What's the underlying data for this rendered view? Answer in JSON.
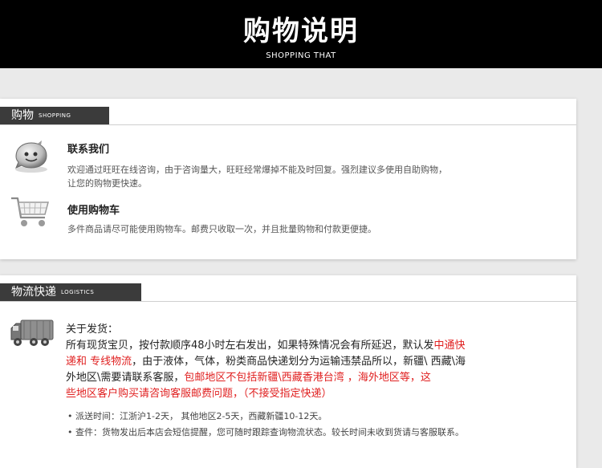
{
  "header": {
    "title": "购物说明",
    "subtitle": "SHOPPING THAT"
  },
  "shopping": {
    "tab_cn": "购物",
    "tab_en": "SHOPPING",
    "contact": {
      "icon": "wangwang-chat-icon",
      "title": "联系我们",
      "desc_line1": "欢迎通过旺旺在线咨询，由于咨询量大，旺旺经常爆掉不能及时回复。强烈建议多使用自助购物，",
      "desc_line2": "让您的购物更快速。"
    },
    "cart": {
      "icon": "shopping-cart-icon",
      "title": "使用购物车",
      "desc": "多件商品请尽可能使用购物车。邮费只收取一次，并且批量购物和付款更便捷。"
    }
  },
  "logistics": {
    "tab_cn": "物流快递",
    "tab_en": "LOGISTICS",
    "icon": "delivery-truck-icon",
    "heading": "关于发货：",
    "p1": "所有现货宝贝，按付款顺序48小时左右发出，如果特殊情况会有所延迟，默认发",
    "p1_red": "中通快",
    "p2_red": "递和 专线物流",
    "p2": "，由于液体，气体，粉类商品快递划分为运输违禁品所以，新疆\\ 西藏\\海",
    "p3": "外地区\\需要请联系客服，",
    "p3_red": "包邮地区不包括新疆\\西藏香港台湾 ，海外地区等，这",
    "p4_red": "些地区客户购买请咨询客服邮费问题，（不接受指定快递）",
    "note1": "• 派送时间：江浙沪1-2天， 其他地区2-5天，西藏新疆10-12天。",
    "note2": "• 查件：货物发出后本店会短信提醒，您可随时跟踪查询物流状态。较长时间未收到货请与客服联系。"
  },
  "colors": {
    "header_bg": "#000000",
    "tab_bg": "#3b3b3b",
    "accent_red": "#e02020",
    "page_bg": "#eaeaea"
  }
}
